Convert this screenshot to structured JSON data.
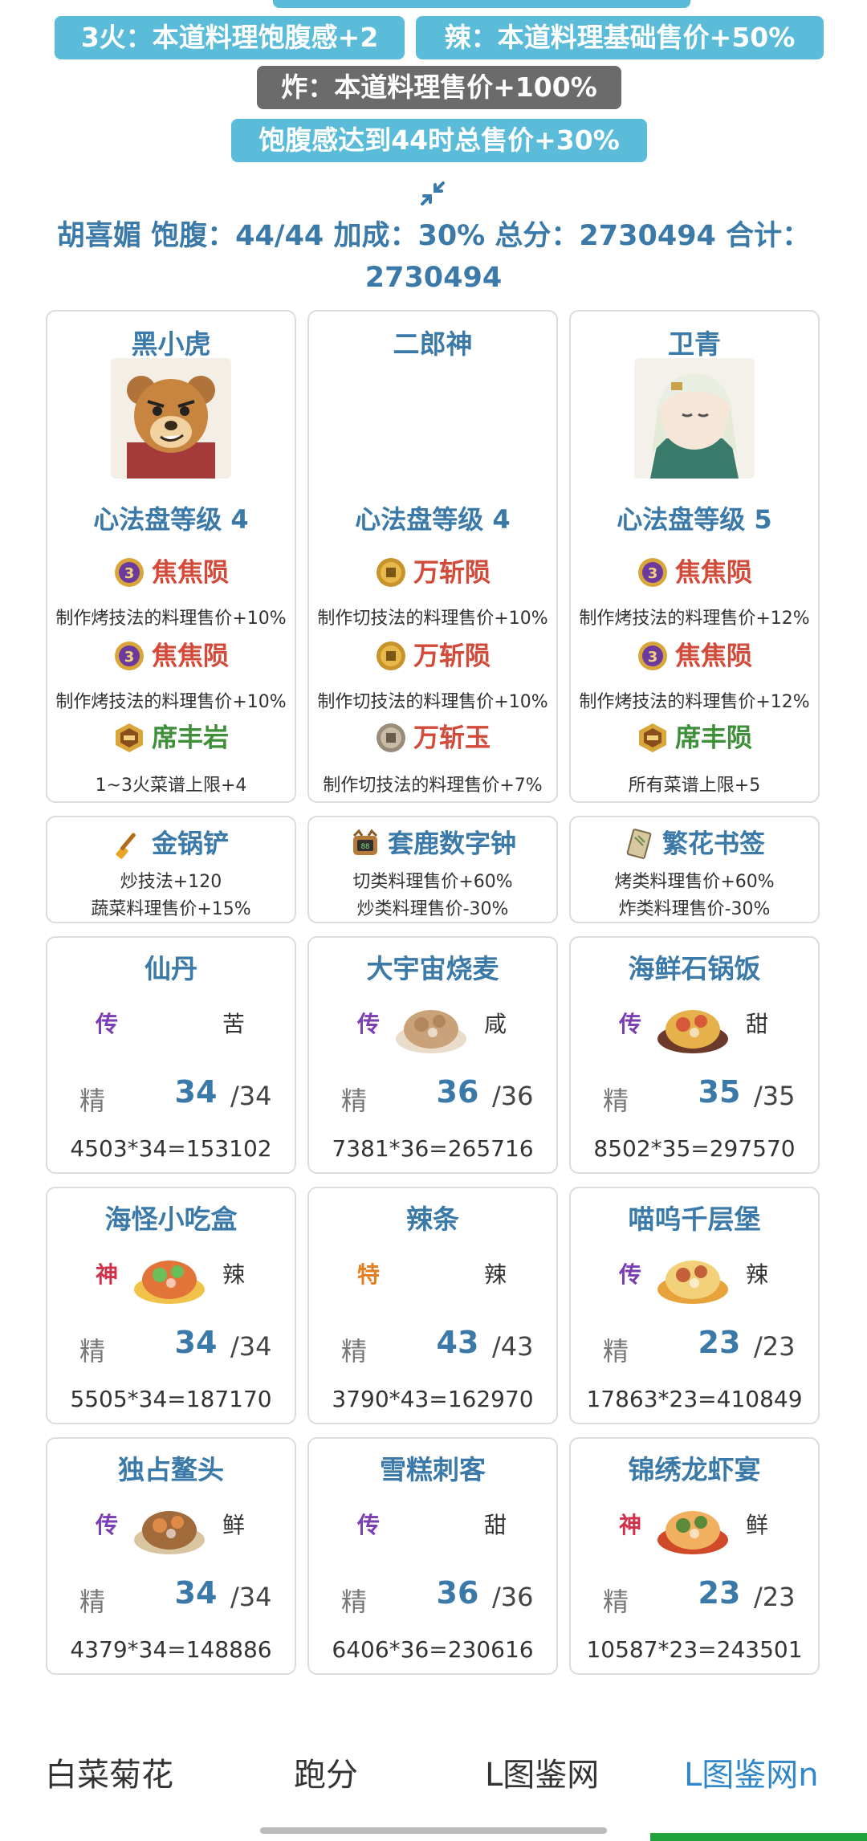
{
  "tags": {
    "t1": "3火：本道料理饱腹感+2",
    "t2": "辣：本道料理基础售价+50%",
    "t3": "炸：本道料理售价+100%",
    "t4": "饱腹感达到44时总售价+30%"
  },
  "summary": {
    "line1": "胡喜媚 饱腹：44/44 加成：30% 总分：2730494 合计：",
    "line2": "2730494"
  },
  "chefs": [
    {
      "name": "黑小虎",
      "level": "心法盘等级 4",
      "skills": [
        {
          "name": "焦焦陨",
          "desc": "制作烤技法的料理售价+10%",
          "icon": "purple-medal-icon"
        },
        {
          "name": "焦焦陨",
          "desc": "制作烤技法的料理售价+10%",
          "icon": "purple-medal-icon"
        },
        {
          "name": "席丰岩",
          "desc": "1~3火菜谱上限+4",
          "icon": "hex-rock-icon"
        }
      ]
    },
    {
      "name": "二郎神",
      "level": "心法盘等级 4",
      "skills": [
        {
          "name": "万斩陨",
          "desc": "制作切技法的料理售价+10%",
          "icon": "gold-medal-icon"
        },
        {
          "name": "万斩陨",
          "desc": "制作切技法的料理售价+10%",
          "icon": "gold-medal-icon"
        },
        {
          "name": "万斩玉",
          "desc": "制作切技法的料理售价+7%",
          "icon": "silver-medal-icon"
        }
      ]
    },
    {
      "name": "卫青",
      "level": "心法盘等级 5",
      "skills": [
        {
          "name": "焦焦陨",
          "desc": "制作烤技法的料理售价+12%",
          "icon": "purple-medal-icon"
        },
        {
          "name": "焦焦陨",
          "desc": "制作烤技法的料理售价+12%",
          "icon": "purple-medal-icon"
        },
        {
          "name": "席丰陨",
          "desc": "所有菜谱上限+5",
          "icon": "hex-rock-icon"
        }
      ]
    }
  ],
  "equipment": [
    {
      "name": "金锅铲",
      "line1": "炒技法+120",
      "line2": "蔬菜料理售价+15%",
      "icon": "golden-spatula-icon"
    },
    {
      "name": "套鹿数字钟",
      "line1": "切类料理售价+60%",
      "line2": "炒类料理售价-30%",
      "icon": "digital-clock-icon"
    },
    {
      "name": "繁花书签",
      "line1": "烤类料理售价+60%",
      "line2": "炸类料理售价-30%",
      "icon": "bookmark-icon"
    }
  ],
  "recipes": [
    {
      "name": "仙丹",
      "rarity": "传",
      "flavor": "苦",
      "jing": "精",
      "count": "34",
      "max": "/34",
      "formula": "4503*34=153102",
      "dish": false
    },
    {
      "name": "大宇宙烧麦",
      "rarity": "传",
      "flavor": "咸",
      "jing": "精",
      "count": "36",
      "max": "/36",
      "formula": "7381*36=265716",
      "dish": true
    },
    {
      "name": "海鲜石锅饭",
      "rarity": "传",
      "flavor": "甜",
      "jing": "精",
      "count": "35",
      "max": "/35",
      "formula": "8502*35=297570",
      "dish": true
    },
    {
      "name": "海怪小吃盒",
      "rarity": "神",
      "flavor": "辣",
      "jing": "精",
      "count": "34",
      "max": "/34",
      "formula": "5505*34=187170",
      "dish": true
    },
    {
      "name": "辣条",
      "rarity": "特",
      "flavor": "辣",
      "jing": "精",
      "count": "43",
      "max": "/43",
      "formula": "3790*43=162970",
      "dish": false
    },
    {
      "name": "喵呜千层堡",
      "rarity": "传",
      "flavor": "辣",
      "jing": "精",
      "count": "23",
      "max": "/23",
      "formula": "17863*23=410849",
      "dish": true
    },
    {
      "name": "独占鳌头",
      "rarity": "传",
      "flavor": "鲜",
      "jing": "精",
      "count": "34",
      "max": "/34",
      "formula": "4379*34=148886",
      "dish": true
    },
    {
      "name": "雪糕刺客",
      "rarity": "传",
      "flavor": "甜",
      "jing": "精",
      "count": "36",
      "max": "/36",
      "formula": "6406*36=230616",
      "dish": false
    },
    {
      "name": "锦绣龙虾宴",
      "rarity": "神",
      "flavor": "鲜",
      "jing": "精",
      "count": "23",
      "max": "/23",
      "formula": "10587*23=243501",
      "dish": true
    }
  ],
  "nav": {
    "n1": "白菜菊花",
    "n2": "跑分",
    "n3": "L图鉴网",
    "n4": "L图鉴网n"
  },
  "colors": {
    "accent": "#3a79a8",
    "tag_blue": "#5bbcd9",
    "tag_gray": "#6b6b6b",
    "skill_red": "#d24a3a",
    "skill_green": "#3f8f3a",
    "rarity_legend": "#7b3fb4",
    "rarity_god": "#d0314a",
    "rarity_special": "#e57e1e",
    "nav_active": "#2f86c8"
  }
}
